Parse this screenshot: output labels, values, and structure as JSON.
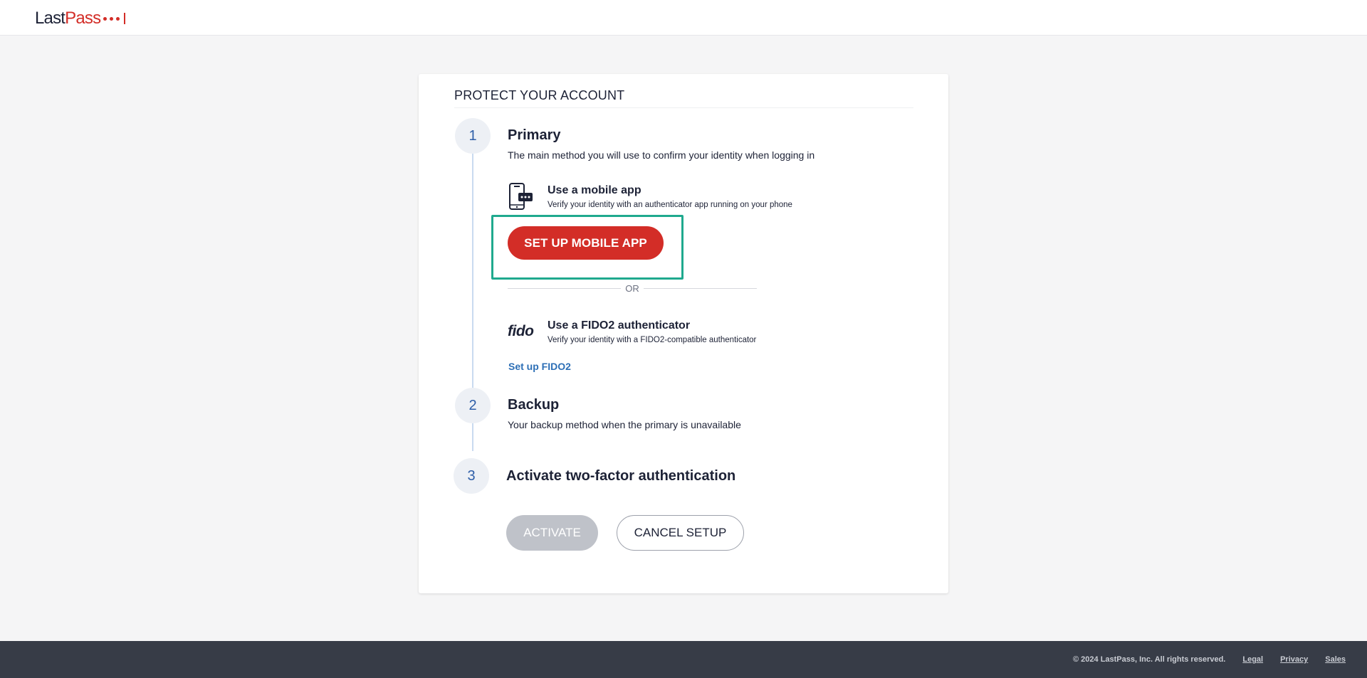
{
  "header": {
    "logo_text_last": "Last",
    "logo_text_pass": "Pass"
  },
  "card": {
    "title": "PROTECT YOUR ACCOUNT",
    "steps": [
      {
        "number": "1",
        "heading": "Primary",
        "description": "The main method you will use to confirm your identity when logging in"
      },
      {
        "number": "2",
        "heading": "Backup",
        "description": "Your backup method when the primary is unavailable"
      },
      {
        "number": "3",
        "heading": "Activate two-factor authentication"
      }
    ],
    "mobile_method": {
      "icon": "mobile-phone-icon",
      "title": "Use a mobile app",
      "description": "Verify your identity with an authenticator app running on your phone",
      "button_label": "SET UP MOBILE APP"
    },
    "separator_label": "OR",
    "fido_method": {
      "logo_text": "fido",
      "title": "Use a FIDO2 authenticator",
      "description": "Verify your identity with a FIDO2-compatible authenticator",
      "link_label": "Set up FIDO2"
    },
    "activate_label": "ACTIVATE",
    "cancel_label": "CANCEL SETUP"
  },
  "footer": {
    "copyright": "© 2024 LastPass, Inc. All rights reserved.",
    "links": [
      "Legal",
      "Privacy",
      "Sales"
    ]
  },
  "colors": {
    "brand_red": "#d32d27",
    "highlight": "#1fa98e",
    "link_blue": "#2d6fb6",
    "disabled": "#bfc2c9",
    "footer_bg": "#373c47"
  }
}
